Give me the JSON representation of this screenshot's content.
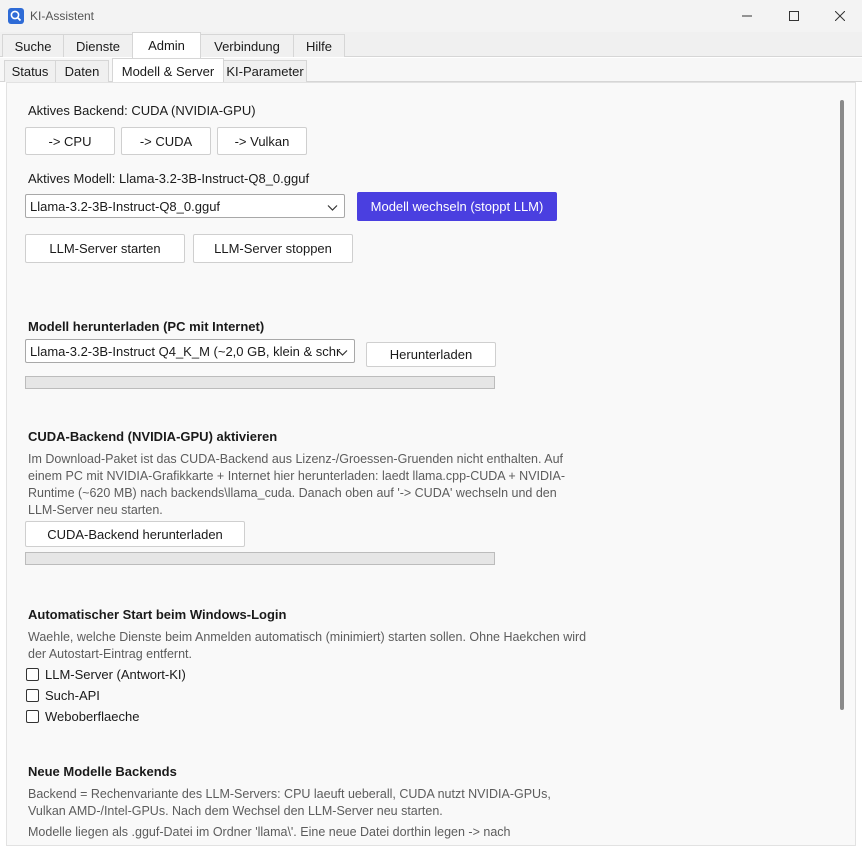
{
  "window": {
    "title": "KI-Assistent"
  },
  "main_tabs": [
    {
      "label": "Suche"
    },
    {
      "label": "Dienste"
    },
    {
      "label": "Admin"
    },
    {
      "label": "Verbindung"
    },
    {
      "label": "Hilfe"
    }
  ],
  "sub_tabs": [
    {
      "label": "Status"
    },
    {
      "label": "Daten"
    },
    {
      "label": "Modell & Server"
    },
    {
      "label": "KI-Parameter"
    }
  ],
  "backend": {
    "active_label": "Aktives Backend: CUDA (NVIDIA-GPU)",
    "buttons": [
      "-> CPU",
      "-> CUDA",
      "-> Vulkan"
    ]
  },
  "model": {
    "active_label": "Aktives Modell: Llama-3.2-3B-Instruct-Q8_0.gguf",
    "selected": "Llama-3.2-3B-Instruct-Q8_0.gguf",
    "switch_button": "Modell wechseln (stoppt LLM)",
    "start_button": "LLM-Server starten",
    "stop_button": "LLM-Server stoppen"
  },
  "download": {
    "heading": "Modell herunterladen (PC mit Internet)",
    "selected": "Llama-3.2-3B-Instruct Q4_K_M  (~2,0 GB, klein & schr",
    "button": "Herunterladen",
    "progress": 0
  },
  "cuda": {
    "heading": "CUDA-Backend (NVIDIA-GPU) aktivieren",
    "description": "Im Download-Paket ist das CUDA-Backend aus Lizenz-/Groessen-Gruenden nicht enthalten. Auf einem PC mit NVIDIA-Grafikkarte + Internet hier herunterladen: laedt llama.cpp-CUDA + NVIDIA-Runtime (~620 MB) nach backends\\llama_cuda. Danach oben auf '-> CUDA' wechseln und den LLM-Server neu starten.",
    "button": "CUDA-Backend herunterladen",
    "progress": 0
  },
  "autostart": {
    "heading": "Automatischer Start beim Windows-Login",
    "description": "Waehle, welche Dienste beim Anmelden automatisch (minimiert) starten sollen. Ohne Haekchen wird der Autostart-Eintrag entfernt.",
    "options": [
      {
        "label": "LLM-Server (Antwort-KI)",
        "checked": false
      },
      {
        "label": "Such-API",
        "checked": false
      },
      {
        "label": "Weboberflaeche",
        "checked": false
      }
    ]
  },
  "info": {
    "heading": "Neue Modelle  Backends",
    "line1": "Backend = Rechenvariante des LLM-Servers: CPU laeuft ueberall, CUDA nutzt NVIDIA-GPUs, Vulkan AMD-/Intel-GPUs. Nach dem Wechsel den LLM-Server neu starten.",
    "line2": "Modelle liegen als .gguf-Datei im Ordner 'llama\\'. Eine neue Datei dorthin legen -> nach"
  },
  "colors": {
    "accent": "#4a3fe0",
    "app_icon": "#2e6bd6"
  }
}
